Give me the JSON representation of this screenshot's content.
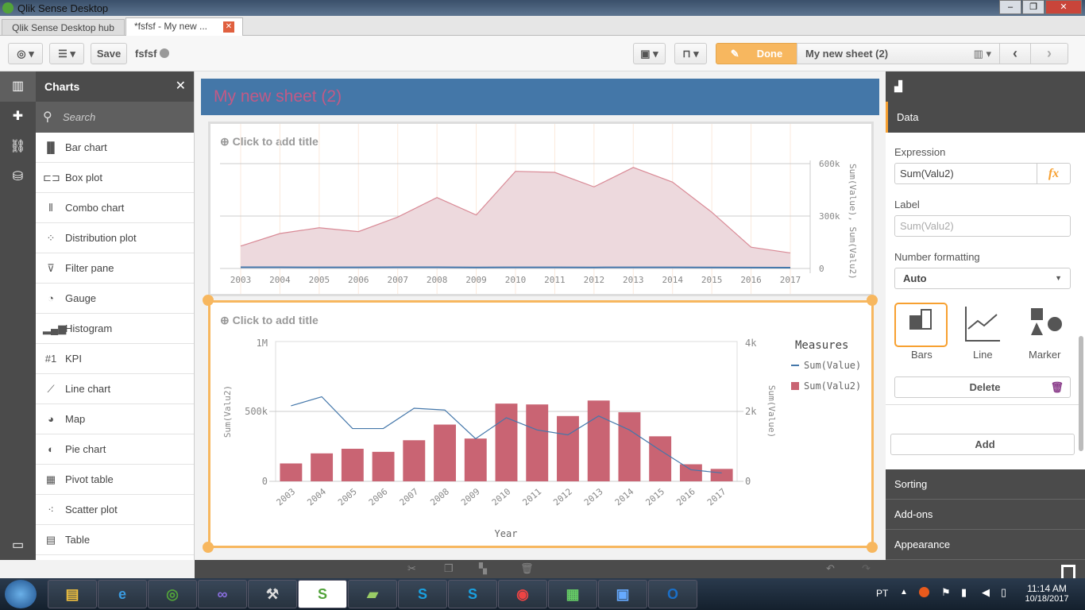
{
  "window": {
    "title": "Qlik Sense Desktop",
    "min": "‒",
    "max": "❐",
    "close": "✕"
  },
  "tabs": [
    {
      "label": "Qlik Sense Desktop hub"
    },
    {
      "label": "*fsfsf - My new ..."
    }
  ],
  "toolbar": {
    "save": "Save",
    "app_name": "fsfsf",
    "done": "Done",
    "sheet_name": "My new sheet (2)"
  },
  "assets": {
    "title": "Charts",
    "search_placeholder": "Search",
    "items": [
      {
        "label": "Bar chart",
        "icon": "▐▌"
      },
      {
        "label": "Box plot",
        "icon": "⊏⊐"
      },
      {
        "label": "Combo chart",
        "icon": "⫴"
      },
      {
        "label": "Distribution plot",
        "icon": "⁘"
      },
      {
        "label": "Filter pane",
        "icon": "⊽"
      },
      {
        "label": "Gauge",
        "icon": "◔"
      },
      {
        "label": "Histogram",
        "icon": "▂▄▆"
      },
      {
        "label": "KPI",
        "icon": "#1"
      },
      {
        "label": "Line chart",
        "icon": "⟋"
      },
      {
        "label": "Map",
        "icon": "◕"
      },
      {
        "label": "Pie chart",
        "icon": "◐"
      },
      {
        "label": "Pivot table",
        "icon": "▦"
      },
      {
        "label": "Scatter plot",
        "icon": "⁖"
      },
      {
        "label": "Table",
        "icon": "▤"
      }
    ]
  },
  "sheet": {
    "title": "My new sheet (2)"
  },
  "colors": {
    "accent": "#f7b75f",
    "bar": "#c96473",
    "line": "#4477aa",
    "sheet_bg": "#4477a8"
  },
  "chart_data": [
    {
      "type": "area",
      "title": "Click to add title",
      "categories": [
        "2003",
        "2004",
        "2005",
        "2006",
        "2007",
        "2008",
        "2009",
        "2010",
        "2011",
        "2012",
        "2013",
        "2014",
        "2015",
        "2016",
        "2017"
      ],
      "series": [
        {
          "name": "Sum(Value)",
          "values": [
            2160,
            2420,
            1510,
            1510,
            2090,
            2040,
            1220,
            1820,
            1470,
            1330,
            1870,
            1470,
            890,
            330,
            240
          ]
        },
        {
          "name": "Sum(Valu2)",
          "values": [
            128000,
            200000,
            233000,
            211000,
            294000,
            406000,
            306000,
            556000,
            550000,
            467000,
            578000,
            494000,
            322000,
            122000,
            89000
          ]
        }
      ],
      "ylabel": "Sum(Value), Sum(Valu2)",
      "ylim": [
        0,
        600000
      ],
      "yticks": [
        "0",
        "300k",
        "600k"
      ]
    },
    {
      "type": "combo",
      "title": "Click to add title",
      "xlabel": "Year",
      "ylabel_left": "Sum(Valu2)",
      "ylabel_right": "Sum(Value)",
      "yticks_left": [
        "0",
        "500k",
        "1M"
      ],
      "yticks_right": [
        "0",
        "2k",
        "4k"
      ],
      "ylim_left": [
        0,
        1000000
      ],
      "ylim_right": [
        0,
        4000
      ],
      "legend_title": "Measures",
      "legend": [
        "Sum(Value)",
        "Sum(Valu2)"
      ],
      "legend_position": "right"
    }
  ],
  "panel": {
    "data_tab": "Data",
    "expression_label": "Expression",
    "expression": "Sum(Valu2)",
    "fx": "fx",
    "label_label": "Label",
    "label_placeholder": "Sum(Valu2)",
    "number_formatting_label": "Number formatting",
    "number_formatting": "Auto",
    "types": [
      "Bars",
      "Line",
      "Marker"
    ],
    "delete": "Delete",
    "add": "Add",
    "sections": [
      "Sorting",
      "Add-ons",
      "Appearance"
    ]
  },
  "taskbar": {
    "lang": "PT",
    "time": "11:14 AM",
    "date": "10/18/2017"
  }
}
